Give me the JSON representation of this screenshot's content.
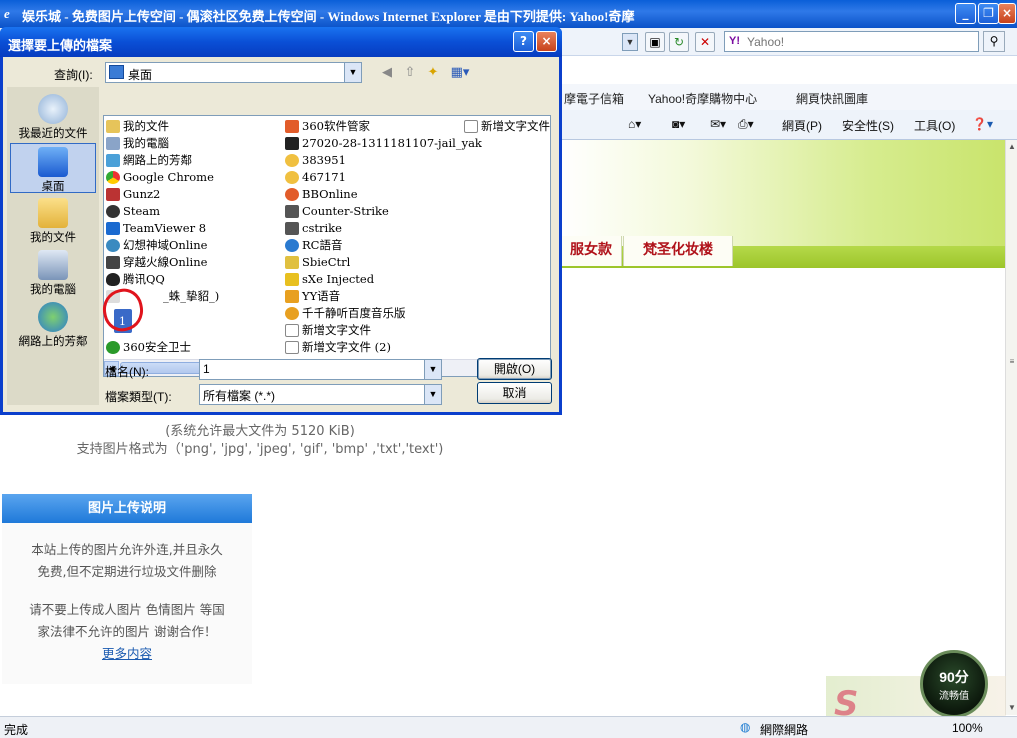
{
  "ie": {
    "title": "娱乐城 - 免费图片上传空间 - 偶滚社区免费上传空间 - Windows Internet Explorer 是由下列提供: Yahoo!奇摩",
    "search_placeholder": "Yahoo!",
    "favorites": [
      "摩電子信箱",
      "Yahoo!奇摩購物中心",
      "網頁快訊圖庫"
    ],
    "commands": [
      "網頁(P)",
      "安全性(S)",
      "工具(O)"
    ]
  },
  "page": {
    "tabs": [
      "服女款",
      "梵圣化妆楼"
    ],
    "hint_line1": "(系统允许最大文件为 5120 KiB)",
    "hint_line2": "支持图片格式为（'png', 'jpg', 'jpeg', 'gif', 'bmp' ,'txt','text')",
    "info_title": "图片上传说明",
    "info_p1a": "本站上传的图片允许外连,并且永久",
    "info_p1b": "免费,但不定期进行垃圾文件删除",
    "info_p2a": "请不要上传成人图片 色情图片 等国",
    "info_p2b": "家法律不允许的图片 谢谢合作！",
    "info_more": "更多内容",
    "fluency_value": "90分",
    "fluency_label": "流畅值"
  },
  "status": {
    "text": "完成",
    "zone": "網際網路",
    "zoom": "100%"
  },
  "dialog": {
    "title": "選擇要上傳的檔案",
    "look_in_label": "查詢(I):",
    "look_in_value": "桌面",
    "places": [
      "我最近的文件",
      "桌面",
      "我的文件",
      "我的電腦",
      "網路上的芳鄰"
    ],
    "col1": [
      "我的文件",
      "我的電腦",
      "網路上的芳鄰",
      "Google Chrome",
      "Gunz2",
      "Steam",
      "TeamViewer 8",
      "幻想神域Online",
      "穿越火線Online",
      "腾讯QQ",
      "_蛛_挚貂_)",
      "1",
      "360安全卫士"
    ],
    "col2": [
      "360软件管家",
      "27020-28-1311181107-jail_yak",
      "383951",
      "467171",
      "BBOnline",
      "Counter-Strike",
      "cstrike",
      "RC語音",
      "SbieCtrl",
      "sXe Injected",
      "YY语音",
      "千千静听百度音乐版",
      "新增文字文件",
      "新增文字文件 (2)"
    ],
    "col3": [
      "新增文字文件"
    ],
    "filename_label": "檔名(N):",
    "filename_value": "1",
    "filetype_label": "檔案類型(T):",
    "filetype_value": "所有檔案 (*.*)",
    "open_btn": "開啟(O)",
    "cancel_btn": "取消"
  }
}
